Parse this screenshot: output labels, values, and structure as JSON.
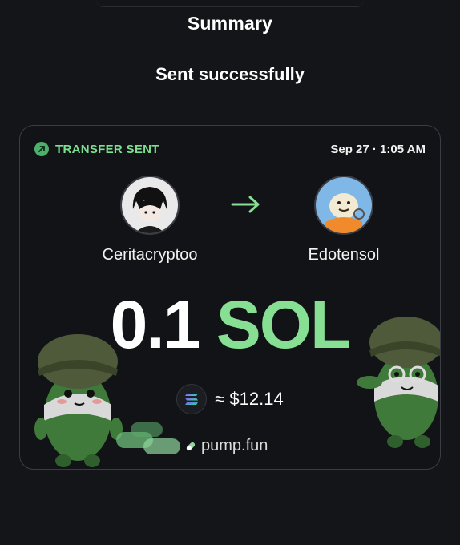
{
  "header": {
    "title": "Summary"
  },
  "status": {
    "message": "Sent successfully"
  },
  "card": {
    "label": "TRANSFER SENT",
    "datetime": "Sep 27 · 1:05 AM",
    "from": {
      "name": "Ceritacryptoo",
      "avatar_icon": "anime-avatar"
    },
    "to": {
      "name": "Edotensol",
      "avatar_icon": "duck-avatar"
    },
    "amount": {
      "value": "0.1",
      "unit": "SOL"
    },
    "usd_value": "≈ $12.14",
    "brand": "pump.fun"
  },
  "colors": {
    "background": "#141518",
    "card_background": "#121316",
    "accent_green": "#86df93",
    "label_green": "#7be08f"
  }
}
